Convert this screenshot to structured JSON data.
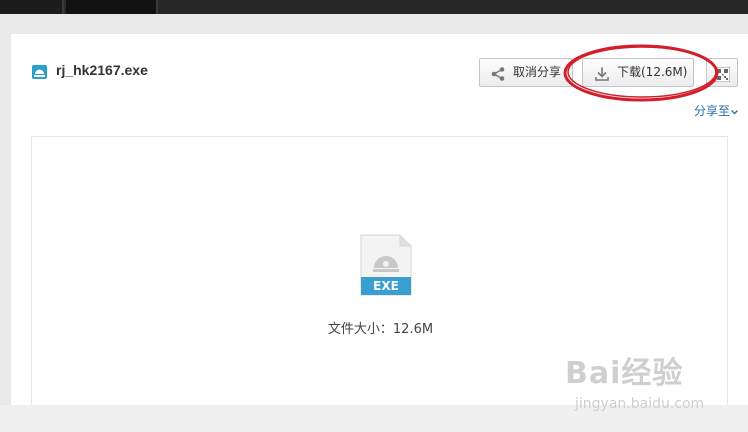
{
  "file": {
    "name": "rj_hk2167.exe",
    "type_label": "EXE",
    "size_text": "文件大小：12.6M"
  },
  "toolbar": {
    "cancel_share_label": "取消分享",
    "download_label": "下载(12.6M)",
    "share_to_label": "分享至"
  },
  "watermark": {
    "brand": "Bai经验",
    "url": "jingyan.baidu.com"
  },
  "colors": {
    "accent_blue": "#2aa0c8",
    "link_blue": "#2a6fb0",
    "annotation_red": "#d21f2b"
  }
}
